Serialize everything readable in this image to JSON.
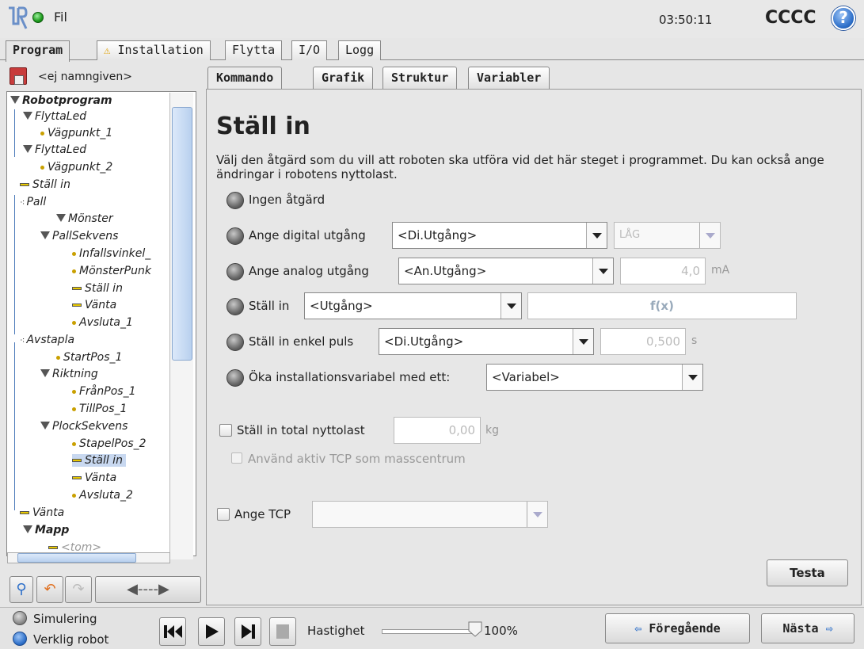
{
  "header": {
    "file_label": "Fil",
    "clock": "03:50:11",
    "robot_name": "CCCC",
    "help_glyph": "?"
  },
  "main_tabs": [
    {
      "label": "Program"
    },
    {
      "label": "Installation",
      "warning": "⚠"
    },
    {
      "label": "Flytta"
    },
    {
      "label": "I/O"
    },
    {
      "label": "Logg"
    }
  ],
  "program": {
    "name": "<ej namngiven>"
  },
  "tree": [
    {
      "label": "Robotprogram"
    },
    {
      "label": "FlyttaLed"
    },
    {
      "label": "Vägpunkt_1"
    },
    {
      "label": "FlyttaLed"
    },
    {
      "label": "Vägpunkt_2"
    },
    {
      "label": "Ställ in"
    },
    {
      "label": "Pall"
    },
    {
      "label": "Mönster"
    },
    {
      "label": "PallSekvens"
    },
    {
      "label": "Infallsvinkel_"
    },
    {
      "label": "MönsterPunk"
    },
    {
      "label": "Ställ in"
    },
    {
      "label": "Vänta"
    },
    {
      "label": "Avsluta_1"
    },
    {
      "label": "Avstapla"
    },
    {
      "label": "StartPos_1"
    },
    {
      "label": "Riktning"
    },
    {
      "label": "FrånPos_1"
    },
    {
      "label": "TillPos_1"
    },
    {
      "label": "PlockSekvens"
    },
    {
      "label": "StapelPos_2"
    },
    {
      "label": "Ställ in"
    },
    {
      "label": "Vänta"
    },
    {
      "label": "Avsluta_2"
    },
    {
      "label": "Vänta"
    },
    {
      "label": "Mapp"
    },
    {
      "label": "<tom>"
    }
  ],
  "tree_selected_index": 21,
  "sub_tabs": [
    {
      "label": "Kommando"
    },
    {
      "label": "Grafik"
    },
    {
      "label": "Struktur"
    },
    {
      "label": "Variabler"
    }
  ],
  "command": {
    "title": "Ställ in",
    "description": "Välj den åtgärd som du vill att roboten ska utföra vid det här steget i programmet. Du kan också ange ändringar i robotens nyttolast.",
    "options": {
      "none": "Ingen åtgärd",
      "digital": {
        "label": "Ange digital utgång",
        "combo": "<Di.Utgång>",
        "state": "LÅG"
      },
      "analog": {
        "label": "Ange analog utgång",
        "combo": "<An.Utgång>",
        "value": "4,0",
        "unit": "mA"
      },
      "set": {
        "label": "Ställ in",
        "combo": "<Utgång>",
        "expr": "f(x)"
      },
      "pulse": {
        "label": "Ställ in enkel puls",
        "combo": "<Di.Utgång>",
        "value": "0,500",
        "unit": "s"
      },
      "increment": {
        "label": "Öka installationsvariabel med ett:",
        "combo": "<Variabel>"
      }
    },
    "payload": {
      "label": "Ställ in total nyttolast",
      "value": "0,00",
      "unit": "kg",
      "tcp_center_label": "Använd aktiv TCP som masscentrum"
    },
    "tcp": {
      "label": "Ange TCP",
      "value": ""
    },
    "test_button": "Testa"
  },
  "footer": {
    "simulation": "Simulering",
    "real_robot": "Verklig robot",
    "speed_label": "Hastighet",
    "speed_value": "100%",
    "speed_fraction": 1.0,
    "prev": "Föregående",
    "next": "Nästa"
  },
  "colors": {
    "accent": "#2d6fc9",
    "selection": "#c8d8f0",
    "tree_line": "#4a78b8"
  }
}
